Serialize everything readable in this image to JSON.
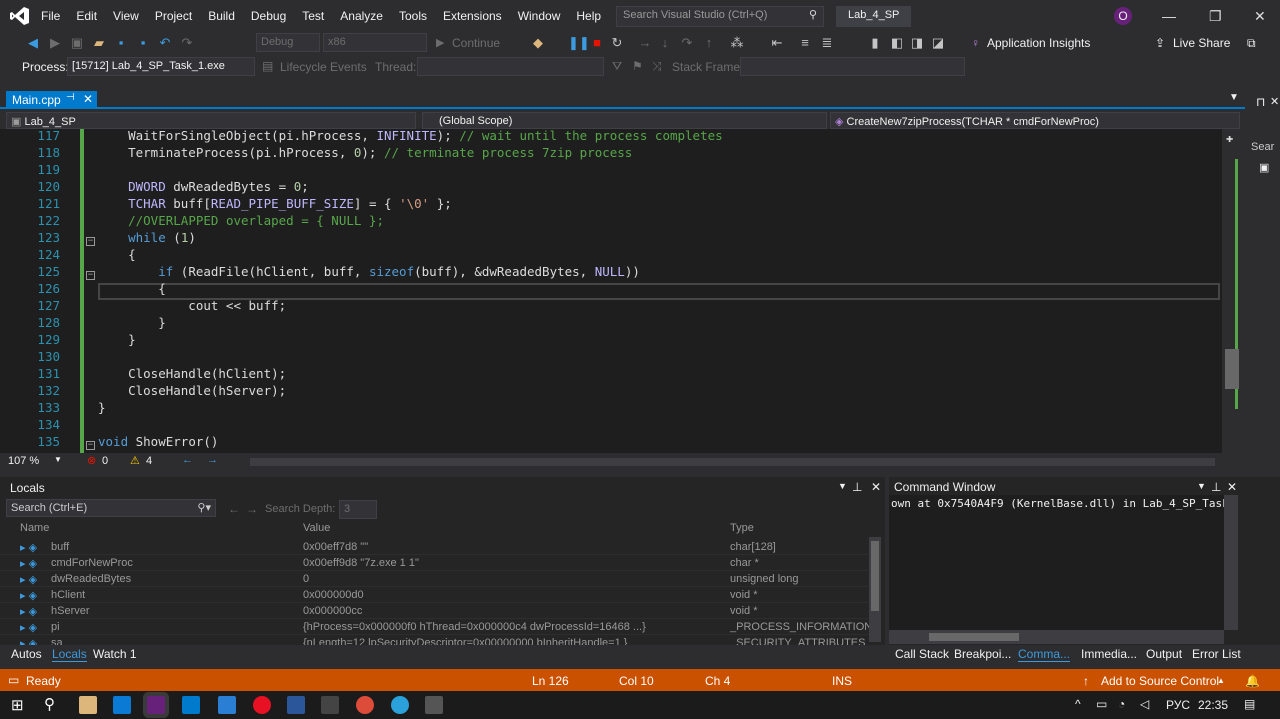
{
  "menu": [
    "File",
    "Edit",
    "View",
    "Project",
    "Build",
    "Debug",
    "Test",
    "Analyze",
    "Tools",
    "Extensions",
    "Window",
    "Help"
  ],
  "search_placeholder": "Search Visual Studio (Ctrl+Q)",
  "solution_name": "Lab_4_SP",
  "account_initial": "O",
  "toolbar": {
    "config": "Debug",
    "platform": "x86",
    "continue": "Continue",
    "app_insights": "Application Insights",
    "live_share": "Live Share",
    "process_label": "Process:",
    "process_value": "[15712] Lab_4_SP_Task_1.exe",
    "lifecycle": "Lifecycle Events",
    "thread_label": "Thread:",
    "stack_frame_label": "Stack Frame:"
  },
  "doc_tab": "Main.cpp",
  "nav": {
    "project": "Lab_4_SP",
    "scope": "(Global Scope)",
    "function": "CreateNew7zipProcess(TCHAR * cmdForNewProc)"
  },
  "side_search": "Sear",
  "code_lines": [
    {
      "n": "117",
      "html": "    WaitForSingleObject(pi.hProcess, <span class='mac'>INFINITE</span>); <span class='cm'>// wait until the process completes</span>"
    },
    {
      "n": "118",
      "html": "    TerminateProcess(pi.hProcess, <span class='num'>0</span>); <span class='cm'>// terminate process 7zip process</span>"
    },
    {
      "n": "119",
      "html": ""
    },
    {
      "n": "120",
      "html": "    <span class='mac'>DWORD</span> dwReadedBytes = <span class='num'>0</span>;"
    },
    {
      "n": "121",
      "html": "    <span class='mac'>TCHAR</span> buff[<span class='mac'>READ_PIPE_BUFF_SIZE</span>] = { <span class='str'>'\\0'</span> };"
    },
    {
      "n": "122",
      "html": "    <span class='cm'>//OVERLAPPED overlaped = { NULL };</span>"
    },
    {
      "n": "123",
      "html": "    <span class='kw'>while</span> (<span class='num'>1</span>)"
    },
    {
      "n": "124",
      "html": "    {"
    },
    {
      "n": "125",
      "html": "        <span class='kw'>if</span> (ReadFile(hClient, buff, <span class='kw'>sizeof</span>(buff), &amp;dwReadedBytes, <span class='mac'>NULL</span>))"
    },
    {
      "n": "126",
      "html": "        {"
    },
    {
      "n": "127",
      "html": "            cout &lt;&lt; buff;"
    },
    {
      "n": "128",
      "html": "        }"
    },
    {
      "n": "129",
      "html": "    }"
    },
    {
      "n": "130",
      "html": ""
    },
    {
      "n": "131",
      "html": "    CloseHandle(hClient);"
    },
    {
      "n": "132",
      "html": "    CloseHandle(hServer);"
    },
    {
      "n": "133",
      "html": "}"
    },
    {
      "n": "134",
      "html": ""
    },
    {
      "n": "135",
      "html": "<span class='kw'>void</span> ShowError()"
    }
  ],
  "editor_status": {
    "zoom": "107 %",
    "errors": "0",
    "warnings": "4"
  },
  "locals": {
    "title": "Locals",
    "search_placeholder": "Search (Ctrl+E)",
    "depth_label": "Search Depth:",
    "depth_value": "3",
    "columns": [
      "Name",
      "Value",
      "Type"
    ],
    "rows": [
      {
        "name": "buff",
        "value": "0x00eff7d8 \"\"",
        "type": "char[128]"
      },
      {
        "name": "cmdForNewProc",
        "value": "0x00eff9d8 \"7z.exe 1 1\"",
        "type": "char *"
      },
      {
        "name": "dwReadedBytes",
        "value": "0",
        "type": "unsigned long"
      },
      {
        "name": "hClient",
        "value": "0x000000d0",
        "type": "void *"
      },
      {
        "name": "hServer",
        "value": "0x000000cc",
        "type": "void *"
      },
      {
        "name": "pi",
        "value": "{hProcess=0x000000f0 hThread=0x000000c4 dwProcessId=16468 ...}",
        "type": "_PROCESS_INFORMATION"
      },
      {
        "name": "sa",
        "value": "{nLength=12 lpSecurityDescriptor=0x00000000 bInheritHandle=1 }",
        "type": "_SECURITY_ATTRIBUTES"
      }
    ]
  },
  "command_window": {
    "title": "Command Window",
    "output": "own at 0x7540A4F9 (KernelBase.dll) in Lab_4_SP_Task"
  },
  "bottom_tabs_left": [
    "Autos",
    "Locals",
    "Watch 1"
  ],
  "bottom_tabs_right": [
    "Call Stack",
    "Breakpoi...",
    "Comma...",
    "Immedia...",
    "Output",
    "Error List"
  ],
  "status": {
    "ready": "Ready",
    "ln": "Ln 126",
    "col": "Col 10",
    "ch": "Ch 4",
    "ins": "INS",
    "source_control": "Add to Source Control"
  },
  "tray": {
    "lang": "РУС",
    "time": "22:35"
  },
  "colors": {
    "accent": "#007acc",
    "status_bar": "#ca5100",
    "editor_bg": "#1e1e1e"
  }
}
